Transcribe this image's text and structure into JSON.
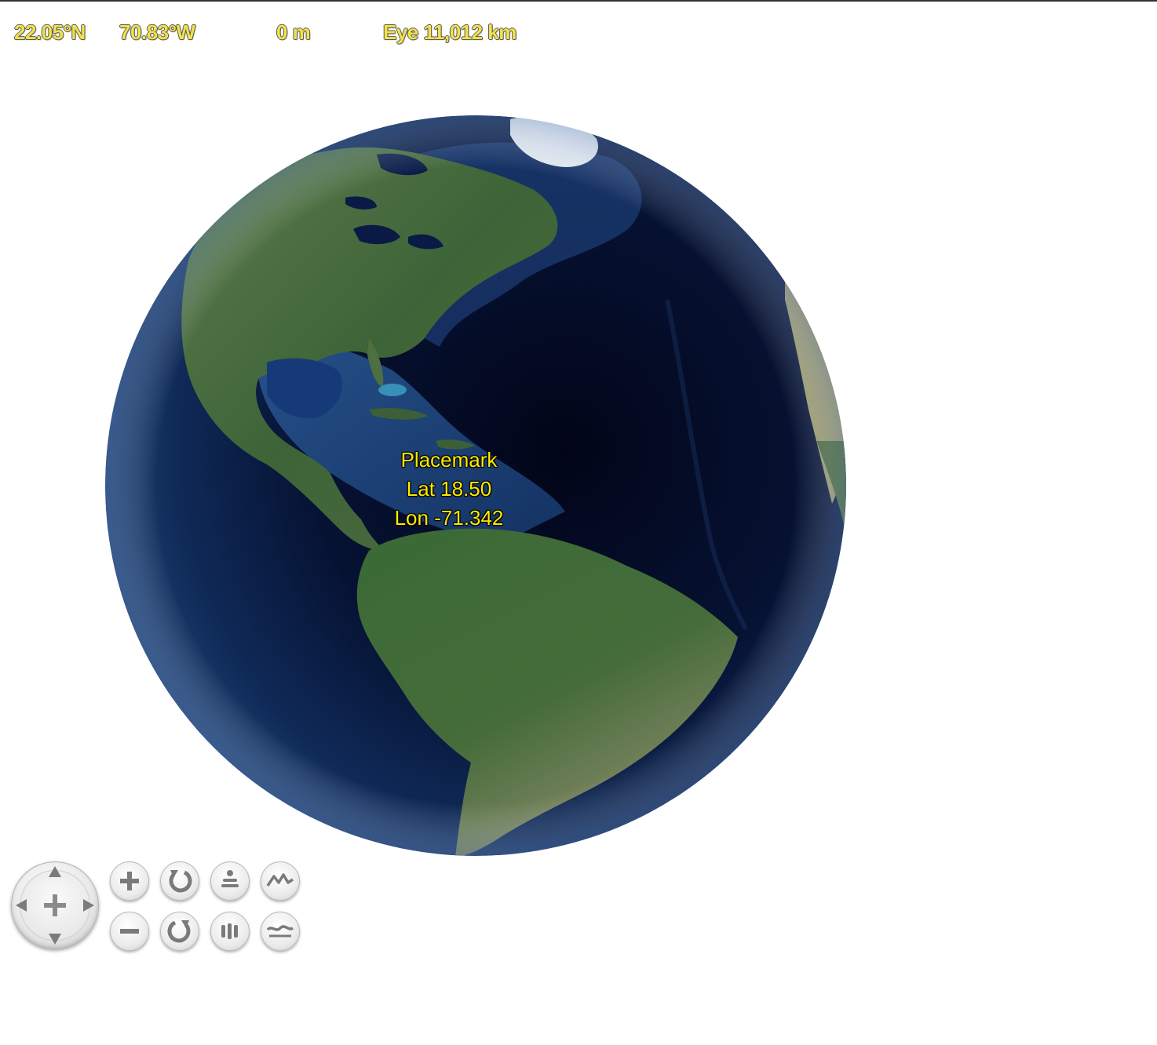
{
  "status_bar": {
    "latitude": "22.05°N",
    "longitude": "70.83°W",
    "elevation": "0 m",
    "eye_altitude": "Eye  11,012 km"
  },
  "placemark": {
    "name": "Placemark",
    "lat_text": "Lat 18.50",
    "lon_text": "Lon -71.342"
  },
  "colors": {
    "status_text": "#f2e24a",
    "placemark_text": "#ffea00",
    "ocean_deep": "#040a22",
    "land": "#3f6a3a"
  },
  "controls": {
    "pan": "pan-compass-icon",
    "zoom_in": "plus-icon",
    "zoom_out": "minus-icon",
    "rotate_ccw": "rotate-left-icon",
    "rotate_cw": "rotate-right-icon",
    "tilt_up": "tilt-up-icon",
    "tilt_down": "tilt-down-icon",
    "exaggeration_up": "vertical-exaggeration-up-icon",
    "exaggeration_down": "vertical-exaggeration-down-icon"
  }
}
